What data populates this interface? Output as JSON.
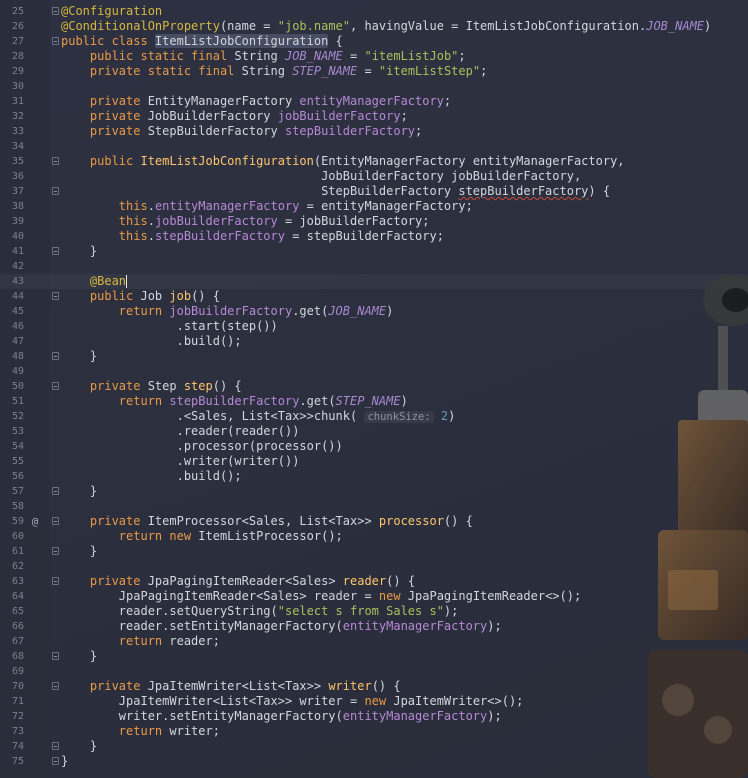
{
  "editor": {
    "lines": [
      {
        "n": "25",
        "fold": true,
        "tokens": [
          {
            "t": "@Configuration",
            "c": "ann"
          }
        ]
      },
      {
        "n": "26",
        "tokens": [
          {
            "t": "@ConditionalOnProperty",
            "c": "ann"
          },
          {
            "t": "(name = "
          },
          {
            "t": "\"job.name\"",
            "c": "str"
          },
          {
            "t": ", havingValue = ItemListJobConfiguration."
          },
          {
            "t": "JOB_NAME",
            "c": "cst"
          },
          {
            "t": ")"
          }
        ]
      },
      {
        "n": "27",
        "fold": true,
        "tokens": [
          {
            "t": "public class ",
            "c": "kw"
          },
          {
            "t": "ItemListJobConfiguration",
            "c": "hl"
          },
          {
            "t": " {"
          }
        ]
      },
      {
        "n": "28",
        "tokens": [
          {
            "t": "    "
          },
          {
            "t": "public static final ",
            "c": "kw"
          },
          {
            "t": "String "
          },
          {
            "t": "JOB_NAME",
            "c": "cst"
          },
          {
            "t": " = "
          },
          {
            "t": "\"itemListJob\"",
            "c": "str"
          },
          {
            "t": ";"
          }
        ]
      },
      {
        "n": "29",
        "tokens": [
          {
            "t": "    "
          },
          {
            "t": "private static final ",
            "c": "kw"
          },
          {
            "t": "String "
          },
          {
            "t": "STEP_NAME",
            "c": "cst"
          },
          {
            "t": " = "
          },
          {
            "t": "\"itemListStep\"",
            "c": "str"
          },
          {
            "t": ";"
          }
        ]
      },
      {
        "n": "30",
        "tokens": []
      },
      {
        "n": "31",
        "tokens": [
          {
            "t": "    "
          },
          {
            "t": "private ",
            "c": "kw"
          },
          {
            "t": "EntityManagerFactory "
          },
          {
            "t": "entityManagerFactory",
            "c": "fld"
          },
          {
            "t": ";"
          }
        ]
      },
      {
        "n": "32",
        "tokens": [
          {
            "t": "    "
          },
          {
            "t": "private ",
            "c": "kw"
          },
          {
            "t": "JobBuilderFactory "
          },
          {
            "t": "jobBuilderFactory",
            "c": "fld"
          },
          {
            "t": ";"
          }
        ]
      },
      {
        "n": "33",
        "tokens": [
          {
            "t": "    "
          },
          {
            "t": "private ",
            "c": "kw"
          },
          {
            "t": "StepBuilderFactory "
          },
          {
            "t": "stepBuilderFactory",
            "c": "fld"
          },
          {
            "t": ";"
          }
        ]
      },
      {
        "n": "34",
        "tokens": []
      },
      {
        "n": "35",
        "fold": true,
        "tokens": [
          {
            "t": "    "
          },
          {
            "t": "public ",
            "c": "kw"
          },
          {
            "t": "ItemListJobConfiguration",
            "c": "fn"
          },
          {
            "t": "(EntityManagerFactory entityManagerFactory,"
          }
        ]
      },
      {
        "n": "36",
        "tokens": [
          {
            "t": "                                    JobBuilderFactory jobBuilderFactory,"
          }
        ]
      },
      {
        "n": "37",
        "fold": true,
        "tokens": [
          {
            "t": "                                    StepBuilderFactory "
          },
          {
            "t": "stepBuilderFactory",
            "c": "err"
          },
          {
            "t": ") {"
          }
        ]
      },
      {
        "n": "38",
        "tokens": [
          {
            "t": "        "
          },
          {
            "t": "this",
            "c": "kw"
          },
          {
            "t": "."
          },
          {
            "t": "entityManagerFactory",
            "c": "fld"
          },
          {
            "t": " = entityManagerFactory;"
          }
        ]
      },
      {
        "n": "39",
        "tokens": [
          {
            "t": "        "
          },
          {
            "t": "this",
            "c": "kw"
          },
          {
            "t": "."
          },
          {
            "t": "jobBuilderFactory",
            "c": "fld"
          },
          {
            "t": " = jobBuilderFactory;"
          }
        ]
      },
      {
        "n": "40",
        "tokens": [
          {
            "t": "        "
          },
          {
            "t": "this",
            "c": "kw"
          },
          {
            "t": "."
          },
          {
            "t": "stepBuilderFactory",
            "c": "fld"
          },
          {
            "t": " = stepBuilderFactory;"
          }
        ]
      },
      {
        "n": "41",
        "fold": true,
        "tokens": [
          {
            "t": "    }"
          }
        ]
      },
      {
        "n": "42",
        "tokens": []
      },
      {
        "n": "43",
        "current": true,
        "tokens": [
          {
            "t": "    "
          },
          {
            "t": "@Bean",
            "c": "ann"
          },
          {
            "t": "|",
            "c": "caret"
          }
        ]
      },
      {
        "n": "44",
        "fold": true,
        "tokens": [
          {
            "t": "    "
          },
          {
            "t": "public ",
            "c": "kw"
          },
          {
            "t": "Job "
          },
          {
            "t": "job",
            "c": "fn"
          },
          {
            "t": "() {"
          }
        ]
      },
      {
        "n": "45",
        "tokens": [
          {
            "t": "        "
          },
          {
            "t": "return ",
            "c": "kw"
          },
          {
            "t": "jobBuilderFactory",
            "c": "fld"
          },
          {
            "t": ".get("
          },
          {
            "t": "JOB_NAME",
            "c": "cst"
          },
          {
            "t": ")"
          }
        ]
      },
      {
        "n": "46",
        "tokens": [
          {
            "t": "                .start(step())"
          }
        ]
      },
      {
        "n": "47",
        "tokens": [
          {
            "t": "                .build();"
          }
        ]
      },
      {
        "n": "48",
        "fold": true,
        "tokens": [
          {
            "t": "    }"
          }
        ]
      },
      {
        "n": "49",
        "tokens": []
      },
      {
        "n": "50",
        "fold": true,
        "tokens": [
          {
            "t": "    "
          },
          {
            "t": "private ",
            "c": "kw"
          },
          {
            "t": "Step "
          },
          {
            "t": "step",
            "c": "fn"
          },
          {
            "t": "() {"
          }
        ]
      },
      {
        "n": "51",
        "tokens": [
          {
            "t": "        "
          },
          {
            "t": "return ",
            "c": "kw"
          },
          {
            "t": "stepBuilderFactory",
            "c": "fld"
          },
          {
            "t": ".get("
          },
          {
            "t": "STEP_NAME",
            "c": "cst"
          },
          {
            "t": ")"
          }
        ]
      },
      {
        "n": "52",
        "tokens": [
          {
            "t": "                .<Sales, List<Tax>>chunk( "
          },
          {
            "t": "chunkSize:",
            "c": "hint"
          },
          {
            "t": " "
          },
          {
            "t": "2",
            "c": "num"
          },
          {
            "t": ")"
          }
        ]
      },
      {
        "n": "53",
        "tokens": [
          {
            "t": "                .reader(reader())"
          }
        ]
      },
      {
        "n": "54",
        "tokens": [
          {
            "t": "                .processor(processor())"
          }
        ]
      },
      {
        "n": "55",
        "tokens": [
          {
            "t": "                .writer(writer())"
          }
        ]
      },
      {
        "n": "56",
        "tokens": [
          {
            "t": "                .build();"
          }
        ]
      },
      {
        "n": "57",
        "fold": true,
        "tokens": [
          {
            "t": "    }"
          }
        ]
      },
      {
        "n": "58",
        "tokens": []
      },
      {
        "n": "59",
        "marker": "@",
        "fold": true,
        "tokens": [
          {
            "t": "    "
          },
          {
            "t": "private ",
            "c": "kw"
          },
          {
            "t": "ItemProcessor<Sales, List<Tax>> "
          },
          {
            "t": "processor",
            "c": "fn"
          },
          {
            "t": "() {"
          }
        ]
      },
      {
        "n": "60",
        "tokens": [
          {
            "t": "        "
          },
          {
            "t": "return new ",
            "c": "kw"
          },
          {
            "t": "ItemListProcessor();"
          }
        ]
      },
      {
        "n": "61",
        "fold": true,
        "tokens": [
          {
            "t": "    }"
          }
        ]
      },
      {
        "n": "62",
        "tokens": []
      },
      {
        "n": "63",
        "fold": true,
        "tokens": [
          {
            "t": "    "
          },
          {
            "t": "private ",
            "c": "kw"
          },
          {
            "t": "JpaPagingItemReader<Sales> "
          },
          {
            "t": "reader",
            "c": "fn"
          },
          {
            "t": "() {"
          }
        ]
      },
      {
        "n": "64",
        "tokens": [
          {
            "t": "        JpaPagingItemReader<Sales> reader = "
          },
          {
            "t": "new ",
            "c": "kw"
          },
          {
            "t": "JpaPagingItemReader<>();"
          }
        ]
      },
      {
        "n": "65",
        "tokens": [
          {
            "t": "        reader.setQueryString("
          },
          {
            "t": "\"select s from Sales s\"",
            "c": "str"
          },
          {
            "t": ");"
          }
        ]
      },
      {
        "n": "66",
        "tokens": [
          {
            "t": "        reader.setEntityManagerFactory("
          },
          {
            "t": "entityManagerFactory",
            "c": "fld"
          },
          {
            "t": ");"
          }
        ]
      },
      {
        "n": "67",
        "tokens": [
          {
            "t": "        "
          },
          {
            "t": "return ",
            "c": "kw"
          },
          {
            "t": "reader;"
          }
        ]
      },
      {
        "n": "68",
        "fold": true,
        "tokens": [
          {
            "t": "    }"
          }
        ]
      },
      {
        "n": "69",
        "tokens": []
      },
      {
        "n": "70",
        "fold": true,
        "tokens": [
          {
            "t": "    "
          },
          {
            "t": "private ",
            "c": "kw"
          },
          {
            "t": "JpaItemWriter<List<Tax>> "
          },
          {
            "t": "writer",
            "c": "fn"
          },
          {
            "t": "() {"
          }
        ]
      },
      {
        "n": "71",
        "tokens": [
          {
            "t": "        JpaItemWriter<List<Tax>> writer = "
          },
          {
            "t": "new ",
            "c": "kw"
          },
          {
            "t": "JpaItemWriter<>();"
          }
        ]
      },
      {
        "n": "72",
        "tokens": [
          {
            "t": "        writer.setEntityManagerFactory("
          },
          {
            "t": "entityManagerFactory",
            "c": "fld"
          },
          {
            "t": ");"
          }
        ]
      },
      {
        "n": "73",
        "tokens": [
          {
            "t": "        "
          },
          {
            "t": "return ",
            "c": "kw"
          },
          {
            "t": "writer;"
          }
        ]
      },
      {
        "n": "74",
        "fold": true,
        "tokens": [
          {
            "t": "    }"
          }
        ]
      },
      {
        "n": "75",
        "fold": true,
        "tokens": [
          {
            "t": "}"
          }
        ]
      }
    ]
  },
  "colors": {
    "background": "#2b2f3e",
    "keyword": "#e99a46",
    "annotation": "#d7b83f",
    "string": "#a5c25c",
    "constant": "#a988cf",
    "field": "#b889d6",
    "method": "#ffc66d",
    "number": "#6897bb"
  },
  "wallpaper": {
    "icon": "robot-wallpaper-icon"
  }
}
